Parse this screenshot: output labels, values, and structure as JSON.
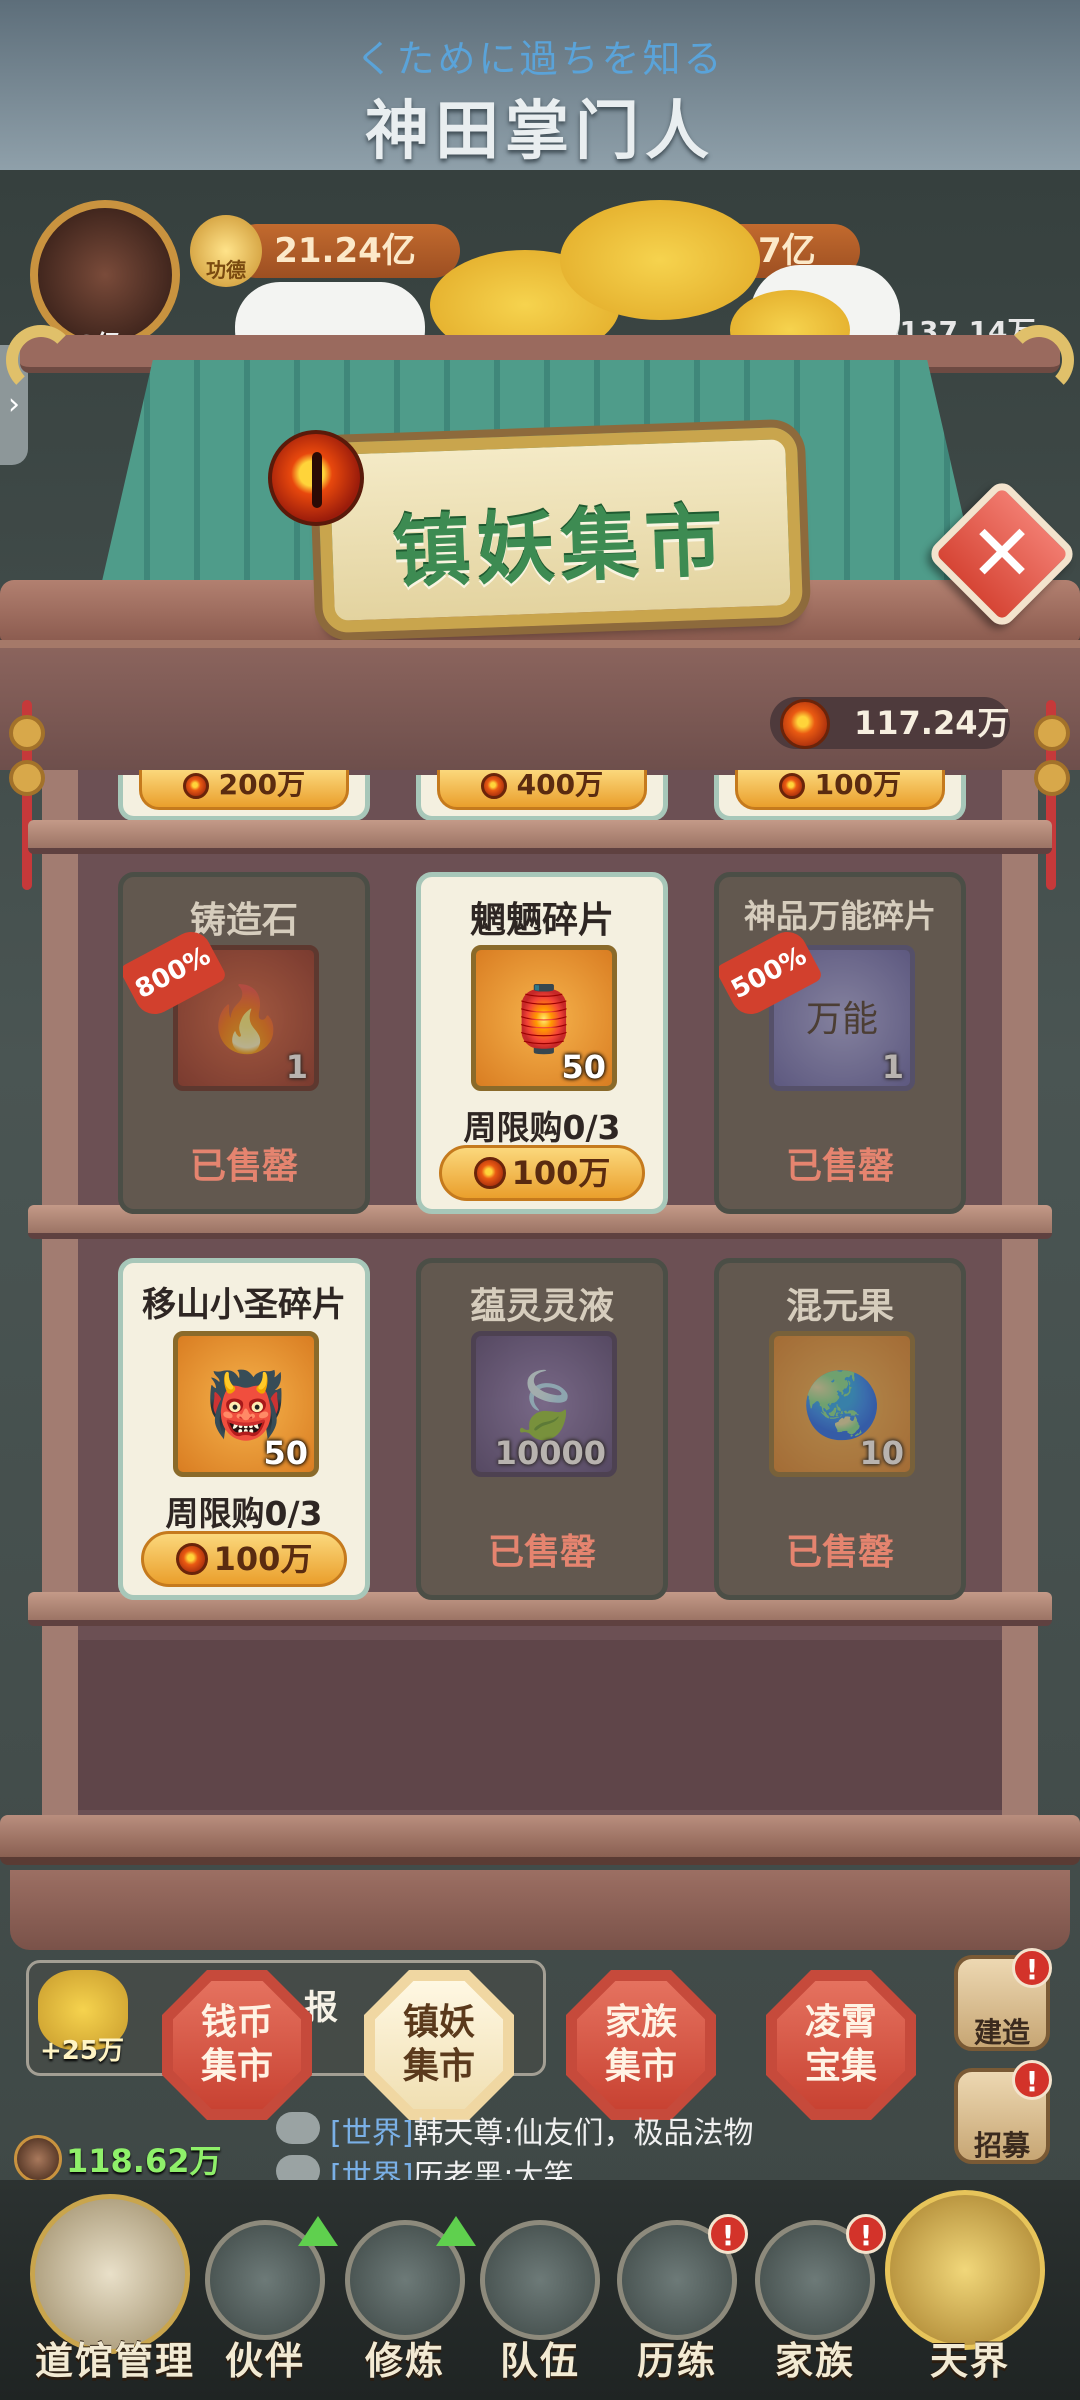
{
  "banner": {
    "subtitle": "くために過ちを知る",
    "logo": "神田掌门人"
  },
  "hud": {
    "avatar_level": "73级",
    "merit_label": "功德",
    "merit_value": "21.24亿",
    "second_value": "37亿",
    "right_value": "4137.14万"
  },
  "shop": {
    "title": "镇妖集市",
    "close_label": "✕",
    "balance": "117.24万",
    "top_row_prices": [
      "200万",
      "400万",
      "100万"
    ],
    "items": [
      {
        "name": "铸造石",
        "qty": "1",
        "badge": "800%",
        "status": "sold",
        "sold_label": "已售罄",
        "icon": "forging-stone-icon",
        "art": "🔥"
      },
      {
        "name": "魍魉碎片",
        "qty": "50",
        "badge": "",
        "status": "available",
        "limit": "周限购0/3",
        "price": "100万",
        "icon": "wangliang-fragment-icon",
        "art": "🏮"
      },
      {
        "name": "神品万能碎片",
        "qty": "1",
        "badge": "500%",
        "status": "sold",
        "sold_label": "已售罄",
        "icon": "universal-fragment-icon",
        "art": "万能"
      },
      {
        "name": "移山小圣碎片",
        "qty": "50",
        "badge": "",
        "status": "available",
        "limit": "周限购0/3",
        "price": "100万",
        "icon": "yishan-fragment-icon",
        "art": "👹"
      },
      {
        "name": "蕴灵灵液",
        "qty": "10000",
        "badge": "",
        "status": "sold",
        "sold_label": "已售罄",
        "icon": "spirit-liquid-icon",
        "art": "🍃"
      },
      {
        "name": "混元果",
        "qty": "10",
        "badge": "",
        "status": "sold",
        "sold_label": "已售罄",
        "icon": "hunyuan-fruit-icon",
        "art": "🌏"
      }
    ]
  },
  "notice": {
    "plus": "+25万",
    "text": "【  宝】报"
  },
  "market_tabs": [
    {
      "label": "钱币\n集市",
      "selected": false
    },
    {
      "label": "镇妖\n集市",
      "selected": true
    },
    {
      "label": "家族\n集市",
      "selected": false
    },
    {
      "label": "凌霄\n宝集",
      "selected": false
    }
  ],
  "side_buttons": {
    "build": "建造",
    "recruit": "招募",
    "alert": "!"
  },
  "chat": {
    "player_power": "118.62万",
    "lines": [
      {
        "channel": "[世界]",
        "text": "韩天尊:仙友们，极品法物"
      },
      {
        "channel": "[世界]",
        "text": "历老黑:大笑"
      }
    ]
  },
  "bottom_nav": [
    {
      "label": "道馆管理"
    },
    {
      "label": "伙伴"
    },
    {
      "label": "修炼"
    },
    {
      "label": "队伍"
    },
    {
      "label": "历练"
    },
    {
      "label": "家族"
    },
    {
      "label": "天界"
    }
  ],
  "colors": {
    "accent_green": "#3d8b52",
    "price_gold": "#ea9f2c",
    "sold_red": "#e5846f",
    "tab_red": "#c64a3b"
  }
}
